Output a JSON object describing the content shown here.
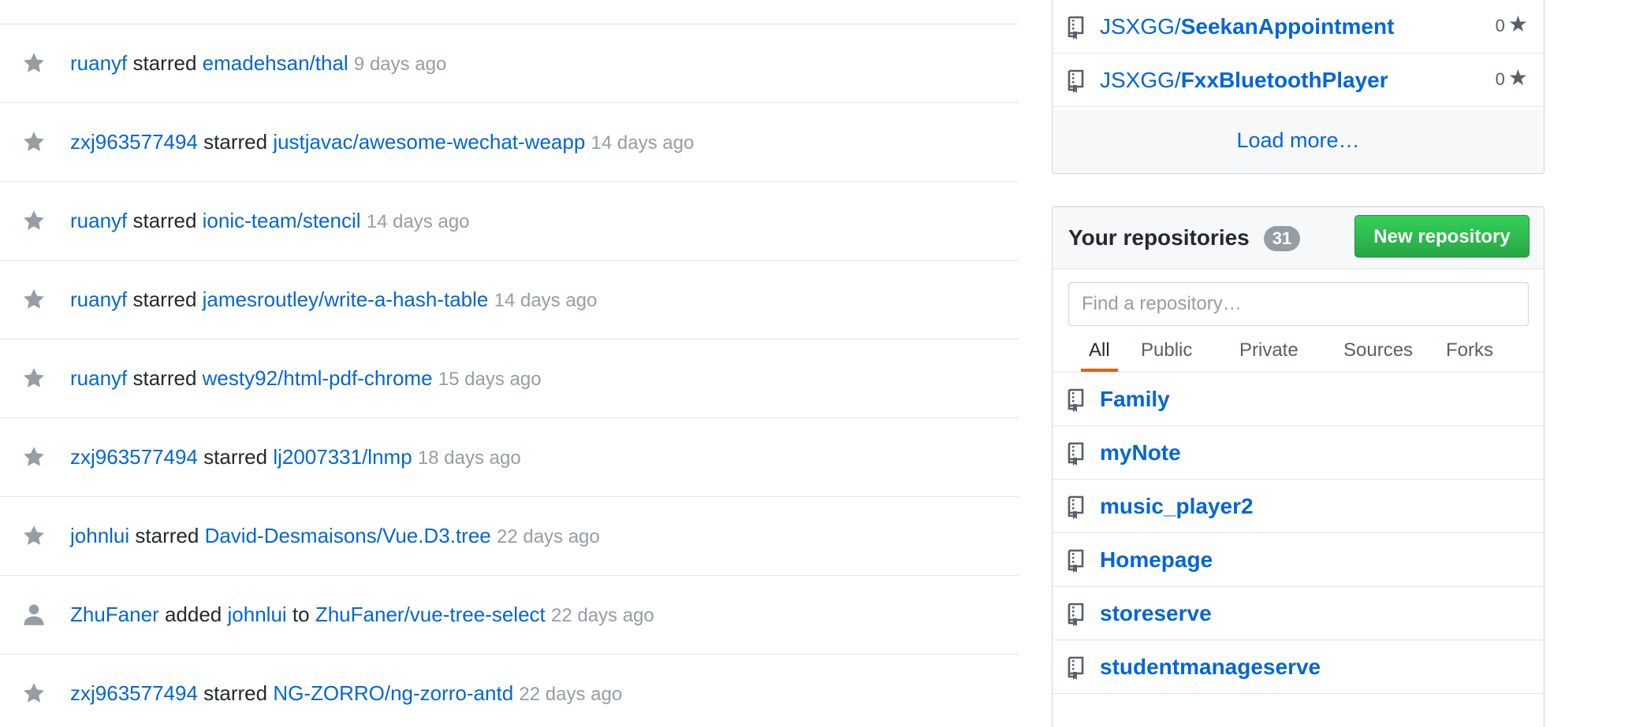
{
  "feed": {
    "items": [
      {
        "icon": "star-icon",
        "actor": "ruanyf",
        "action": "starred",
        "repo": "emadehsan/thal",
        "time": "9 days ago"
      },
      {
        "icon": "star-icon",
        "actor": "zxj963577494",
        "action": "starred",
        "repo": "justjavac/awesome-wechat-weapp",
        "time": "14 days ago"
      },
      {
        "icon": "star-icon",
        "actor": "ruanyf",
        "action": "starred",
        "repo": "ionic-team/stencil",
        "time": "14 days ago"
      },
      {
        "icon": "star-icon",
        "actor": "ruanyf",
        "action": "starred",
        "repo": "jamesroutley/write-a-hash-table",
        "time": "14 days ago"
      },
      {
        "icon": "star-icon",
        "actor": "ruanyf",
        "action": "starred",
        "repo": "westy92/html-pdf-chrome",
        "time": "15 days ago"
      },
      {
        "icon": "star-icon",
        "actor": "zxj963577494",
        "action": "starred",
        "repo": "lj2007331/lnmp",
        "time": "18 days ago"
      },
      {
        "icon": "star-icon",
        "actor": "johnlui",
        "action": "starred",
        "repo": "David-Desmaisons/Vue.D3.tree",
        "time": "22 days ago"
      },
      {
        "icon": "person-icon",
        "actor": "ZhuFaner",
        "action": "added",
        "member": "johnlui",
        "connector": "to",
        "repo": "ZhuFaner/vue-tree-select",
        "time": "22 days ago"
      },
      {
        "icon": "star-icon",
        "actor": "zxj963577494",
        "action": "starred",
        "repo": "NG-ZORRO/ng-zorro-antd",
        "time": "22 days ago"
      }
    ]
  },
  "starred_box": {
    "repos": [
      {
        "owner": "JSXGG/",
        "name": "SeekanAppointment",
        "stars": "0"
      },
      {
        "owner": "JSXGG/",
        "name": "FxxBluetoothPlayer",
        "stars": "0"
      }
    ],
    "load_more": "Load more…"
  },
  "your_repos": {
    "title": "Your repositories",
    "count": "31",
    "new_button": "New repository",
    "search_placeholder": "Find a repository…",
    "tabs": [
      "All",
      "Public",
      "Private",
      "Sources",
      "Forks"
    ],
    "selected_tab": "All",
    "repos": [
      "Family",
      "myNote",
      "music_player2",
      "Homepage",
      "storeserve",
      "studentmanageserve"
    ]
  },
  "colors": {
    "link": "#0366d6",
    "muted": "#959da5",
    "accent_tab": "#e36209",
    "button_green": "#28a745"
  }
}
